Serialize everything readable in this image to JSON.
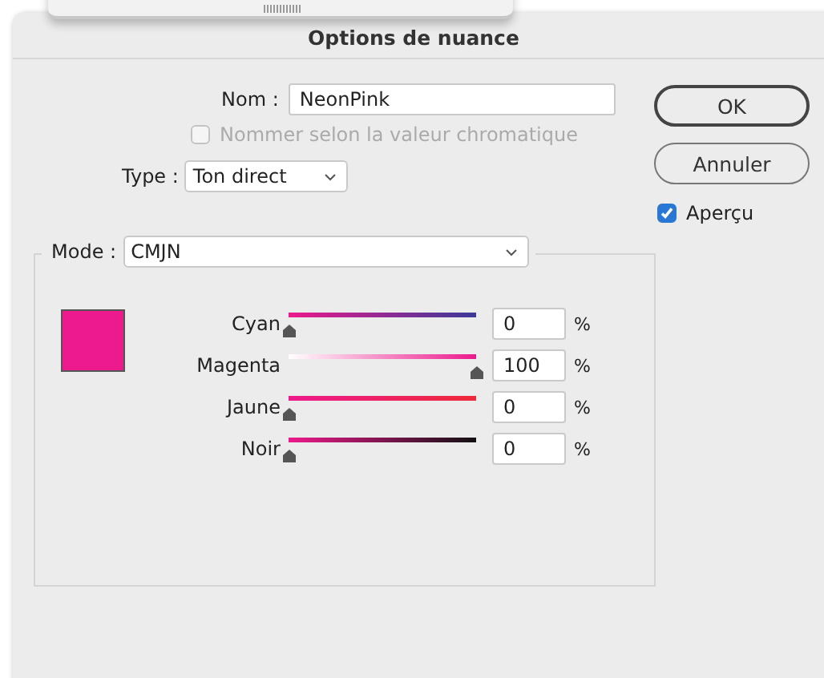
{
  "window": {
    "title": "Options de nuance"
  },
  "name": {
    "label": "Nom :",
    "value": "NeonPink"
  },
  "name_by_value": {
    "label": "Nommer selon la valeur chromatique",
    "checked": false,
    "disabled": true
  },
  "type": {
    "label": "Type :",
    "value": "Ton direct"
  },
  "buttons": [
    {
      "label": "OK",
      "default": true
    },
    {
      "label": "Annuler",
      "default": false
    }
  ],
  "preview": {
    "label": "Aperçu",
    "checked": true
  },
  "mode": {
    "label": "Mode :",
    "value": "CMJN"
  },
  "swatch": {
    "color": "#ec1a8c"
  },
  "channels": [
    {
      "name": "Cyan",
      "level": 0,
      "value": "0",
      "unit": "%"
    },
    {
      "name": "Magenta",
      "level": 1,
      "value": "100",
      "unit": "%"
    },
    {
      "name": "Jaune",
      "level": 0,
      "value": "0",
      "unit": "%"
    },
    {
      "name": "Noir",
      "level": 0,
      "value": "0",
      "unit": "%"
    }
  ]
}
